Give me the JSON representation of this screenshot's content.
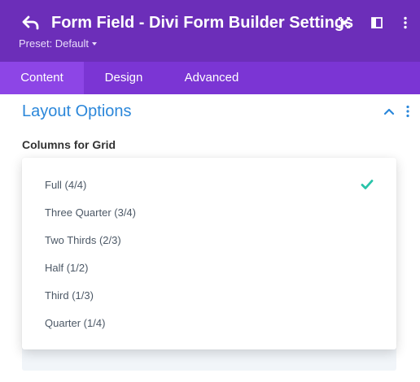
{
  "header": {
    "title": "Form Field - Divi Form Builder Settings",
    "preset_label": "Preset: Default",
    "icons": [
      "back-arrow-icon",
      "fullscreen-icon",
      "split-view-icon",
      "more-vertical-icon"
    ],
    "background_color": "#6c2eb9"
  },
  "tabs": [
    {
      "label": "Content",
      "active": true
    },
    {
      "label": "Design",
      "active": false
    },
    {
      "label": "Advanced",
      "active": false
    }
  ],
  "tabs_background_color": "#7b35d4",
  "section": {
    "title": "Layout Options",
    "expanded": true,
    "title_color": "#2b87da"
  },
  "field": {
    "label": "Columns for Grid",
    "selected": "Full (4/4)",
    "options": [
      {
        "label": "Full (4/4)",
        "selected": true
      },
      {
        "label": "Three Quarter (3/4)",
        "selected": false
      },
      {
        "label": "Two Thirds (2/3)",
        "selected": false
      },
      {
        "label": "Half (1/2)",
        "selected": false
      },
      {
        "label": "Third (1/3)",
        "selected": false
      },
      {
        "label": "Quarter (1/4)",
        "selected": false
      }
    ],
    "check_color": "#29c4a9"
  }
}
